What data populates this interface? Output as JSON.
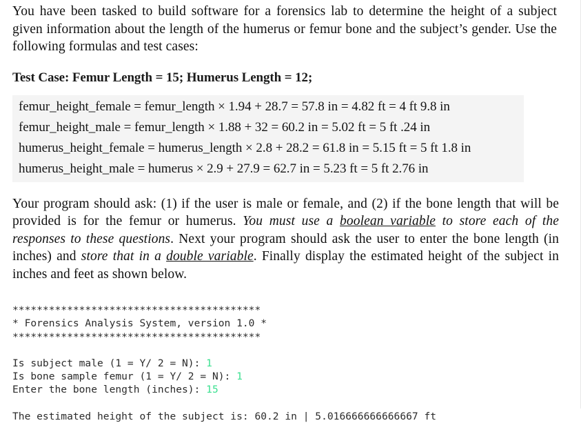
{
  "document": {
    "intro_paragraph": {
      "text": "You have been tasked to build software for a forensics lab to determine the height of a subject given information about the length of the humerus or femur bone and the subject’s gender. Use the following formulas and test cases:"
    },
    "test_case_heading": "Test Case: Femur Length = 15; Humerus Length = 12;",
    "formulas": [
      {
        "name": "femur_height_female",
        "text": "femur_height_female = femur_length × 1.94 + 28.7 = 57.8 in = 4.82 ft = 4 ft 9.8 in"
      },
      {
        "name": "femur_height_male",
        "text": "femur_height_male = femur_length × 1.88 + 32 = 60.2 in = 5.02 ft = 5 ft .24 in"
      },
      {
        "name": "humerus_height_female",
        "text": "humerus_height_female = humerus_length × 2.8 + 28.2 = 61.8 in = 5.15 ft = 5 ft 1.8 in"
      },
      {
        "name": "humerus_height_male",
        "text": "humerus_height_male = humerus × 2.9 + 27.9 = 62.7 in = 5.23 ft = 5 ft 2.76 in"
      }
    ],
    "requirements_paragraph": {
      "part1": "Your program should ask: (1) if the user is male or female, and (2) if the bone length that will be provided is for the femur or humerus. ",
      "italic1_a": "You must use a ",
      "italic1_underline": "boolean variable",
      "italic1_b": " to store each of the responses to these questions",
      "part2": ". Next your program should ask the user to enter the bone length (in inches) and ",
      "italic2_a": "store that in a ",
      "italic2_underline": "double variable",
      "part3": ". Finally display the estimated height of the subject in inches and feet as shown below."
    },
    "console": {
      "banner_top": "*****************************************",
      "banner_title": "* Forensics Analysis System, version 1.0 *",
      "banner_bottom": "*****************************************",
      "prompts": [
        {
          "label": "Is subject male (1 = Y/ 2 = N): ",
          "value": "1"
        },
        {
          "label": "Is bone sample femur (1 = Y/ 2 = N): ",
          "value": "1"
        },
        {
          "label": "Enter the bone length (inches): ",
          "value": "15"
        }
      ],
      "result": "The estimated height of the subject is: 60.2 in | 5.016666666666667 ft",
      "input_color": "#3ae08f"
    }
  }
}
